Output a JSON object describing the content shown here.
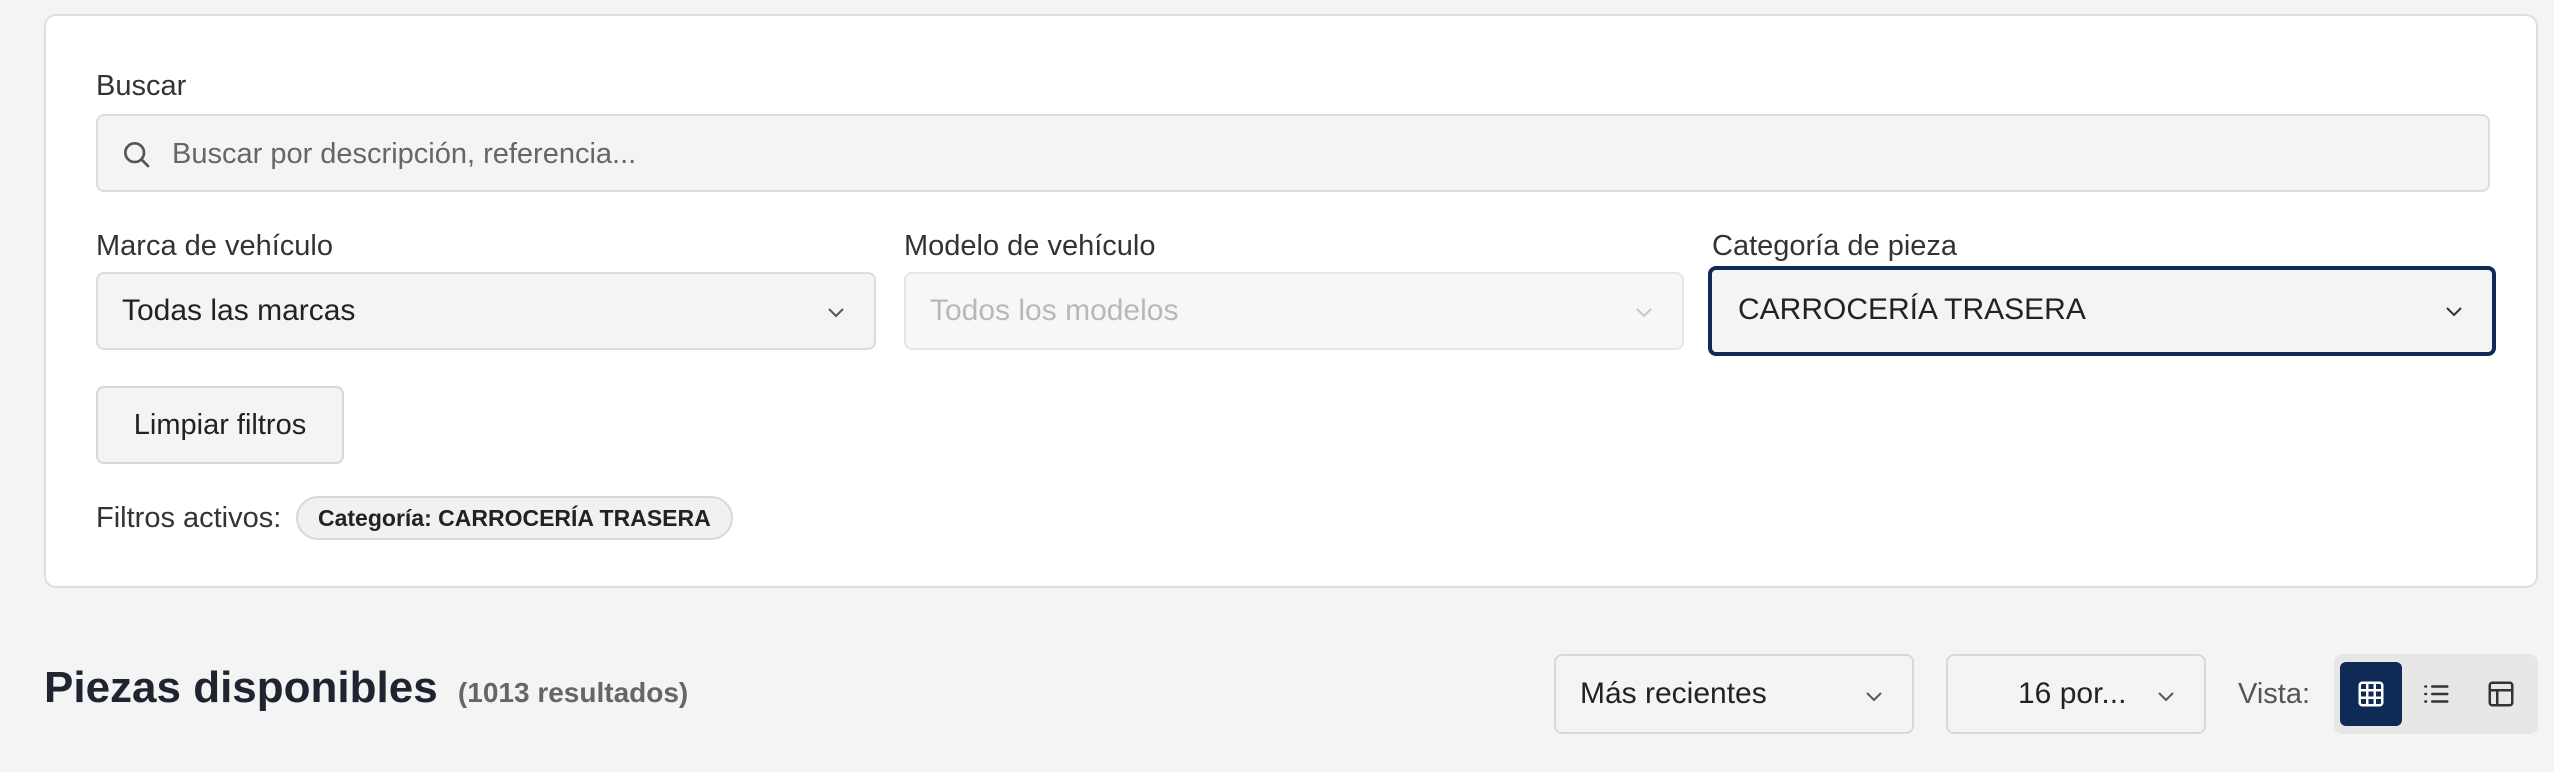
{
  "filters": {
    "search": {
      "label": "Buscar",
      "placeholder": "Buscar por descripción, referencia..."
    },
    "brand": {
      "label": "Marca de vehículo",
      "value": "Todas las marcas"
    },
    "model": {
      "label": "Modelo de vehículo",
      "value": "Todos los modelos",
      "disabled": true
    },
    "category": {
      "label": "Categoría de pieza",
      "value": "CARROCERÍA TRASERA",
      "focused": true
    },
    "clear_label": "Limpiar filtros",
    "active_label": "Filtros activos:",
    "active_chips": [
      "Categoría: CARROCERÍA TRASERA"
    ]
  },
  "results": {
    "title": "Piezas disponibles",
    "count": "(1013 resultados)",
    "sort_value": "Más recientes",
    "per_page_value": "16 por...",
    "view_label": "Vista:",
    "view_modes": [
      {
        "name": "grid",
        "icon": "grid-view-icon",
        "active": true
      },
      {
        "name": "list",
        "icon": "list-view-icon",
        "active": false
      },
      {
        "name": "table",
        "icon": "table-view-icon",
        "active": false
      }
    ]
  },
  "colors": {
    "accent": "#0f2a55",
    "background": "#f4f4f4",
    "card": "#ffffff"
  }
}
